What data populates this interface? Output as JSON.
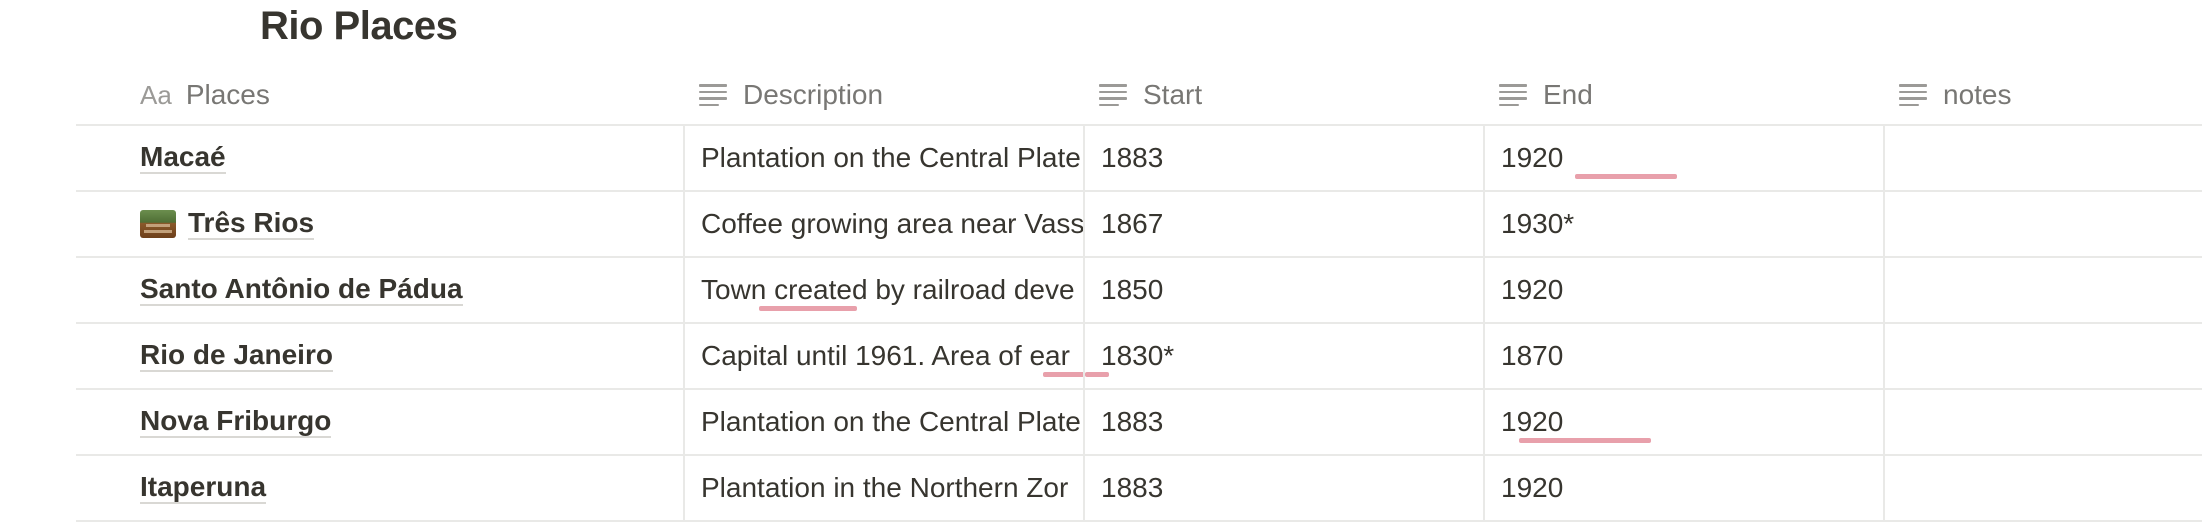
{
  "page": {
    "title": "Rio Places"
  },
  "columns": {
    "places": {
      "label": "Places",
      "icon_text": "Aa",
      "icon": "title-type-icon"
    },
    "description": {
      "label": "Description",
      "icon": "text-lines-icon"
    },
    "start": {
      "label": "Start",
      "icon": "text-lines-icon"
    },
    "end": {
      "label": "End",
      "icon": "text-lines-icon"
    },
    "notes": {
      "label": "notes",
      "icon": "text-lines-icon"
    }
  },
  "rows": [
    {
      "place": "Macaé",
      "description": "Plantation on the Central Plate",
      "start": "1883",
      "end": "1920",
      "notes": ""
    },
    {
      "place": "Três Rios",
      "page_icon": "photo-icon",
      "description": "Coffee growing area near Vass",
      "start": "1867",
      "end": "1930*",
      "notes": ""
    },
    {
      "place": "Santo Antônio de Pádua",
      "description": "Town created by railroad deve",
      "start": "1850",
      "end": "1920",
      "notes": ""
    },
    {
      "place": "Rio de Janeiro",
      "description": "Capital until 1961. Area of ear",
      "start": "1830*",
      "end": "1870",
      "notes": ""
    },
    {
      "place": "Nova Friburgo",
      "description": "Plantation on the Central Plate",
      "start": "1883",
      "end": "1920",
      "notes": ""
    },
    {
      "place": "Itaperuna",
      "description": "Plantation in the Northern Zor",
      "start": "1883",
      "end": "1920",
      "notes": ""
    }
  ],
  "colors": {
    "text": "#37352f",
    "header_text": "#787774",
    "border": "#e9e9e7",
    "spellcheck_underline": "#e8a0ab"
  }
}
